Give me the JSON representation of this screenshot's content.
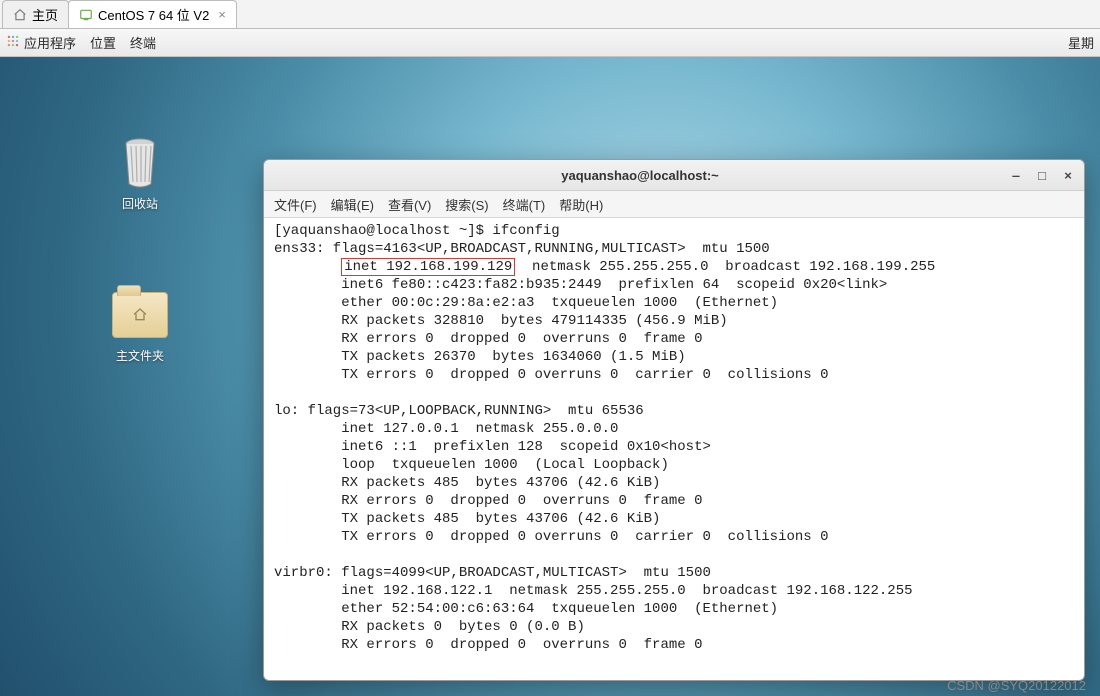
{
  "host_tabs": {
    "home": "主页",
    "centos": "CentOS 7 64 位 V2"
  },
  "gnome": {
    "apps": "应用程序",
    "places": "位置",
    "terminal": "终端",
    "clock": "星期"
  },
  "desktop": {
    "trash": "回收站",
    "homefolder": "主文件夹"
  },
  "terminal": {
    "title": "yaquanshao@localhost:~",
    "menu": {
      "file": "文件(F)",
      "edit": "编辑(E)",
      "view": "查看(V)",
      "search": "搜索(S)",
      "term": "终端(T)",
      "help": "帮助(H)"
    },
    "prompt": "[yaquanshao@localhost ~]$ ifconfig",
    "ens33_a": "ens33: flags=4163<UP,BROADCAST,RUNNING,MULTICAST>  mtu 1500",
    "ens33_inet_hl": "inet 192.168.199.129",
    "ens33_inet_rest": "  netmask 255.255.255.0  broadcast 192.168.199.255",
    "ens33_c": "        inet6 fe80::c423:fa82:b935:2449  prefixlen 64  scopeid 0x20<link>",
    "ens33_d": "        ether 00:0c:29:8a:e2:a3  txqueuelen 1000  (Ethernet)",
    "ens33_e": "        RX packets 328810  bytes 479114335 (456.9 MiB)",
    "ens33_f": "        RX errors 0  dropped 0  overruns 0  frame 0",
    "ens33_g": "        TX packets 26370  bytes 1634060 (1.5 MiB)",
    "ens33_h": "        TX errors 0  dropped 0 overruns 0  carrier 0  collisions 0",
    "lo_a": "lo: flags=73<UP,LOOPBACK,RUNNING>  mtu 65536",
    "lo_b": "        inet 127.0.0.1  netmask 255.0.0.0",
    "lo_c": "        inet6 ::1  prefixlen 128  scopeid 0x10<host>",
    "lo_d": "        loop  txqueuelen 1000  (Local Loopback)",
    "lo_e": "        RX packets 485  bytes 43706 (42.6 KiB)",
    "lo_f": "        RX errors 0  dropped 0  overruns 0  frame 0",
    "lo_g": "        TX packets 485  bytes 43706 (42.6 KiB)",
    "lo_h": "        TX errors 0  dropped 0 overruns 0  carrier 0  collisions 0",
    "v_a": "virbr0: flags=4099<UP,BROADCAST,MULTICAST>  mtu 1500",
    "v_b": "        inet 192.168.122.1  netmask 255.255.255.0  broadcast 192.168.122.255",
    "v_c": "        ether 52:54:00:c6:63:64  txqueuelen 1000  (Ethernet)",
    "v_d": "        RX packets 0  bytes 0 (0.0 B)",
    "v_e": "        RX errors 0  dropped 0  overruns 0  frame 0"
  },
  "watermark": "CSDN @SYQ20122012"
}
